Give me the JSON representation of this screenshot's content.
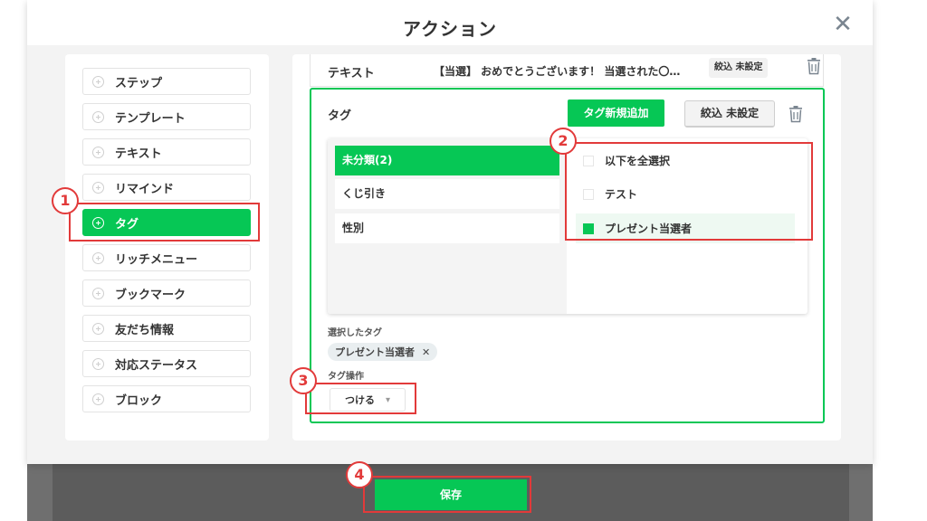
{
  "modal": {
    "title": "アクション",
    "close_glyph": "✕"
  },
  "sidebar": {
    "items": [
      {
        "label": "ステップ",
        "active": false
      },
      {
        "label": "テンプレート",
        "active": false
      },
      {
        "label": "テキスト",
        "active": false
      },
      {
        "label": "リマインド",
        "active": false
      },
      {
        "label": "タグ",
        "active": true
      },
      {
        "label": "リッチメニュー",
        "active": false
      },
      {
        "label": "ブックマーク",
        "active": false
      },
      {
        "label": "友だち情報",
        "active": false
      },
      {
        "label": "対応ステータス",
        "active": false
      },
      {
        "label": "ブロック",
        "active": false
      }
    ]
  },
  "text_action": {
    "label": "テキスト",
    "message": "【当選】 おめでとうございます！ 当選された〇…",
    "filter_label": "絞込 未設定"
  },
  "tag_action": {
    "label": "タグ",
    "new_tag_button": "タグ新規追加",
    "filter_button": "絞込 未設定",
    "categories": [
      {
        "label": "未分類(2)",
        "active": true
      },
      {
        "label": "くじ引き",
        "active": false
      },
      {
        "label": "性別",
        "active": false
      }
    ],
    "options": [
      {
        "label": "以下を全選択",
        "checked": false
      },
      {
        "label": "テスト",
        "checked": false
      },
      {
        "label": "プレゼント当選者",
        "checked": true
      }
    ],
    "selected_label": "選択したタグ",
    "selected_chip": "プレゼント当選者",
    "chip_remove_glyph": "✕",
    "operation_label": "タグ操作",
    "operation_value": "つける"
  },
  "footer": {
    "save_label": "保存"
  },
  "annotations": {
    "badges": [
      "1",
      "2",
      "3",
      "4"
    ],
    "color": "#e23a3a"
  },
  "colors": {
    "accent": "#06c755"
  }
}
